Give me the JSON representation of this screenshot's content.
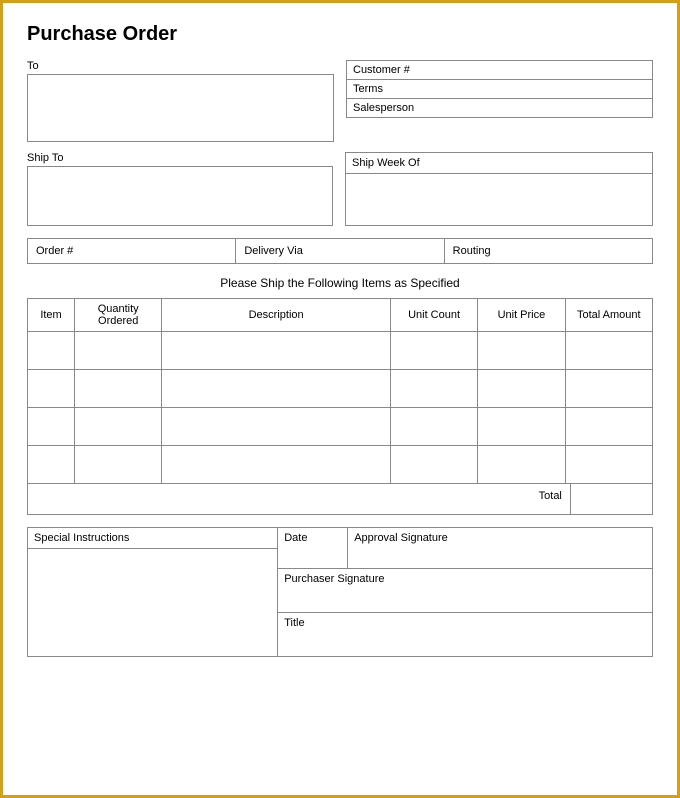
{
  "page": {
    "title": "Purchase Order",
    "border_color": "#d4a017"
  },
  "header": {
    "to_label": "To",
    "customer_label": "Customer #",
    "terms_label": "Terms",
    "salesperson_label": "Salesperson",
    "ship_week_of_label": "Ship Week Of",
    "ship_to_label": "Ship To"
  },
  "order_row": {
    "order_num_label": "Order #",
    "delivery_via_label": "Delivery Via",
    "routing_label": "Routing"
  },
  "subtitle": "Please Ship the Following Items as Specified",
  "table": {
    "columns": [
      {
        "id": "item",
        "label": "Item"
      },
      {
        "id": "qty_ordered",
        "label": "Quantity Ordered"
      },
      {
        "id": "description",
        "label": "Description"
      },
      {
        "id": "unit_count",
        "label": "Unit Count"
      },
      {
        "id": "unit_price",
        "label": "Unit Price"
      },
      {
        "id": "total_amount",
        "label": "Total Amount"
      }
    ],
    "rows": [
      {
        "item": "",
        "qty_ordered": "",
        "description": "",
        "unit_count": "",
        "unit_price": "",
        "total_amount": ""
      },
      {
        "item": "",
        "qty_ordered": "",
        "description": "",
        "unit_count": "",
        "unit_price": "",
        "total_amount": ""
      },
      {
        "item": "",
        "qty_ordered": "",
        "description": "",
        "unit_count": "",
        "unit_price": "",
        "total_amount": ""
      },
      {
        "item": "",
        "qty_ordered": "",
        "description": "",
        "unit_count": "",
        "unit_price": "",
        "total_amount": ""
      }
    ],
    "total_label": "Total"
  },
  "footer": {
    "special_instructions_label": "Special Instructions",
    "date_label": "Date",
    "approval_signature_label": "Approval Signature",
    "purchaser_signature_label": "Purchaser Signature",
    "title_label": "Title"
  }
}
